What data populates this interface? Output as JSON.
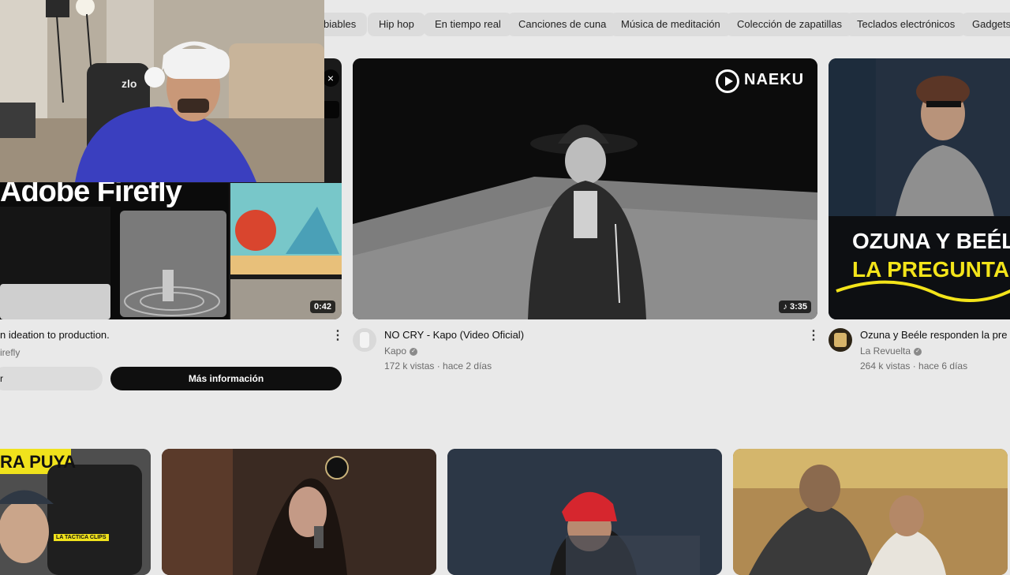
{
  "chips": [
    "biables",
    "Hip hop",
    "En tiempo real",
    "Canciones de cuna",
    "Música de meditación",
    "Colección de zapatillas",
    "Teclados electrónicos",
    "Gadgets"
  ],
  "ad": {
    "title": "n ideation to production.",
    "brand": "irefly",
    "banner_text": "Adobe Firefly",
    "duration": "0:42",
    "secondary_button": "r",
    "cta": "Más información",
    "close_glyph": "×"
  },
  "videos": [
    {
      "title": "NO CRY - Kapo (Video Oficial)",
      "channel": "Kapo",
      "stats": "172 k vistas · hace 2 días",
      "duration": "3:35",
      "watermark": "NAEKU"
    },
    {
      "title": "Ozuna y Beéle responden la pre",
      "channel": "La Revuelta",
      "stats": "264 k vistas · hace 6 días",
      "overlay_line1": "OZUNA Y BEÉLE R",
      "overlay_line2": "LA PREGUNTA DE"
    }
  ],
  "row2": {
    "thumb1_text": "RA PUYA",
    "thumb1_sub": "LA TACTICA CLIPS"
  },
  "webcam": {
    "chair_brand": "zlo"
  },
  "colors": {
    "cta_bg": "#0f0f0f",
    "ozuna_yellow": "#f3e41a",
    "page_bg": "#e9e9e9"
  }
}
